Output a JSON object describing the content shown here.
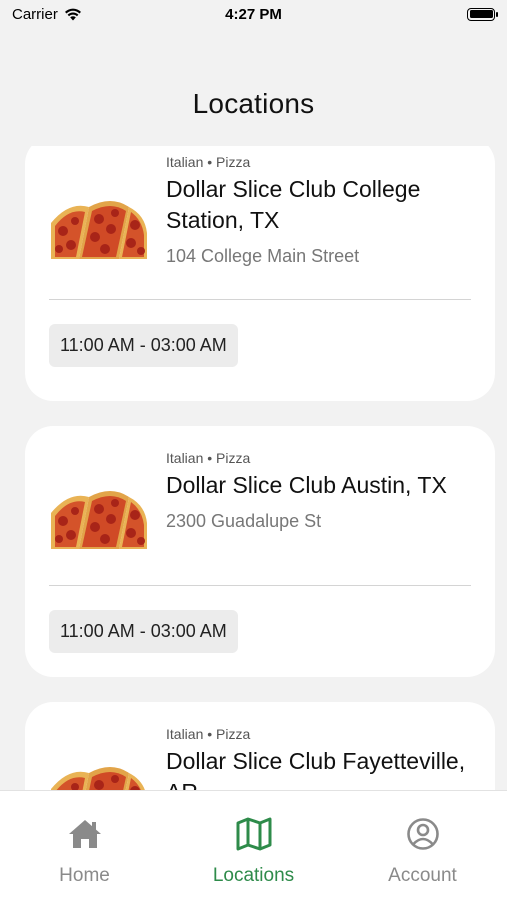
{
  "status_bar": {
    "carrier": "Carrier",
    "time": "4:27 PM"
  },
  "header": {
    "title": "Locations"
  },
  "locations": [
    {
      "tags": "Italian • Pizza",
      "name": "Dollar Slice Club College Station, TX",
      "address": "104 College Main Street",
      "hours": "11:00 AM - 03:00 AM"
    },
    {
      "tags": "Italian • Pizza",
      "name": "Dollar Slice Club Austin, TX",
      "address": "2300 Guadalupe St",
      "hours": "11:00 AM - 03:00 AM"
    },
    {
      "tags": "Italian • Pizza",
      "name": "Dollar Slice Club Fayetteville, AR",
      "address": "",
      "hours": ""
    }
  ],
  "tab_bar": {
    "items": [
      {
        "label": "Home",
        "icon": "home-icon"
      },
      {
        "label": "Locations",
        "icon": "map-icon"
      },
      {
        "label": "Account",
        "icon": "account-icon"
      }
    ],
    "active_color": "#2e8b4a",
    "inactive_color": "#8a8a8a"
  }
}
